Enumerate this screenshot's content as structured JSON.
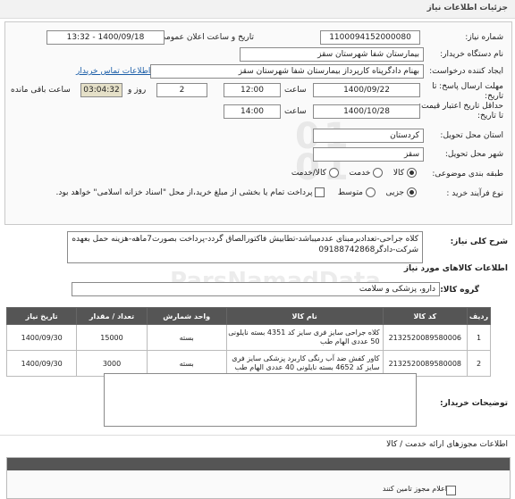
{
  "header": {
    "title": "جزئیات اطلاعات نیاز"
  },
  "form": {
    "need_number_label": "شماره نیاز:",
    "need_number": "1100094152000080",
    "announce_label": "تاریخ و ساعت اعلان عمومی:",
    "announce_value": "1400/09/18 - 13:32",
    "buyer_label": "نام دستگاه خریدار:",
    "buyer_value": "بیمارستان شفا شهرستان سقز",
    "creator_label": "ایجاد کننده درخواست:",
    "creator_value": "بهنام دادگرپناه کارپرداز بیمارستان شفا شهرستان سقز",
    "contact_link": "اطلاعات تماس خریدار",
    "deadline_label": "مهلت ارسال پاسخ: تا تاریخ:",
    "deadline_date": "1400/09/22",
    "time_word": "ساعت",
    "deadline_time": "12:00",
    "days_value": "2",
    "days_word": "روز و",
    "remaining_time": "03:04:32",
    "remaining_label": "ساعت باقی مانده",
    "validity_label": "حداقل تاریخ اعتبار قیمت: تا تاریخ:",
    "validity_date": "1400/10/28",
    "validity_time": "14:00",
    "province_label": "استان محل تحویل:",
    "province_value": "کردستان",
    "city_label": "شهر محل تحویل:",
    "city_value": "سقز",
    "category_label": "طبقه بندی موضوعی:",
    "category_options": [
      "کالا",
      "خدمت",
      "کالا/خدمت"
    ],
    "process_label": "نوع فرآیند خرید :",
    "process_options": [
      "جزیی",
      "متوسط"
    ],
    "payment_note": "پرداخت تمام یا بخشی از مبلغ خرید،از محل \"اسناد خزانه اسلامی\" خواهد بود."
  },
  "summary": {
    "label": "شرح کلی نیاز:",
    "text": "کلاه جراحی-تعدادبرمبنای عددمیباشد-تطابیش فاکتورالصاق گردد-پرداخت بصورت7ماهه-هزینه حمل بعهده شرکت-دادگر09188742868"
  },
  "goods": {
    "section_title": "اطلاعات کالاهای مورد نیاز",
    "group_label": "گروه کالا:",
    "group_value": "دارو، پزشکی و سلامت",
    "columns": [
      "ردیف",
      "کد کالا",
      "نام کالا",
      "واحد شمارش",
      "تعداد / مقدار",
      "تاریخ نیاز"
    ],
    "rows": [
      {
        "idx": "1",
        "code": "2132520089580006",
        "name": "کلاه جراحی سایز فری سایز کد 4351 بسته نایلونی 50 عددی الهام طب",
        "unit": "بسته",
        "qty": "15000",
        "date": "1400/09/30"
      },
      {
        "idx": "2",
        "code": "2132520089580008",
        "name": "کاور کفش ضد آب رنگی کاربرد پزشکی سایز فری سایز کد 4652 بسته نایلونی 40 عددی الهام طب",
        "unit": "بسته",
        "qty": "3000",
        "date": "1400/09/30"
      }
    ]
  },
  "buyer_notes": {
    "label": "توضیحات خریدار:"
  },
  "permits": {
    "title": "اطلاعات مجوزهای ارائه خدمت / کالا",
    "partial_text": "اعلام مجوز تامین کنند"
  },
  "watermark": {
    "text": "ParsNamadData",
    "lines": [
      "01",
      "01"
    ]
  }
}
